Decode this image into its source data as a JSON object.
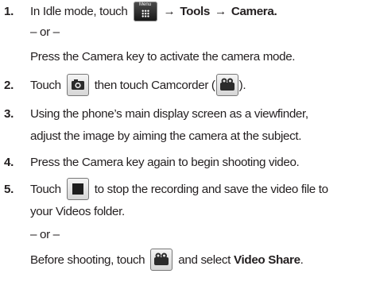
{
  "steps": [
    {
      "number": "1.",
      "text_a": "In Idle mode, touch",
      "menu_icon_caption": "Menu",
      "text_b": "→",
      "text_c": "Tools",
      "text_d": "→",
      "text_e": "Camera.",
      "or": "– or –",
      "alt": "Press the Camera key to activate the camera mode."
    },
    {
      "number": "2.",
      "text_a": "Touch",
      "text_b": "then touch Camcorder (",
      "text_c": ")."
    },
    {
      "number": "3.",
      "line1": "Using the phone’s main display screen as a viewfinder,",
      "line2": "adjust the image by aiming the camera at the subject."
    },
    {
      "number": "4.",
      "line1": "Press the Camera key again to begin shooting video."
    },
    {
      "number": "5.",
      "text_a": "Touch",
      "text_b": "to stop the recording and save the video file to",
      "line2": "your Videos folder.",
      "or": "– or –",
      "alt_a": "Before shooting, touch",
      "alt_b": "and select",
      "alt_c": "Video Share",
      "alt_d": "."
    }
  ],
  "icons": {
    "menu": "menu-grid-icon",
    "camera": "camera-icon",
    "camcorder": "camcorder-icon",
    "stop": "stop-icon",
    "share": "camcorder-icon"
  }
}
